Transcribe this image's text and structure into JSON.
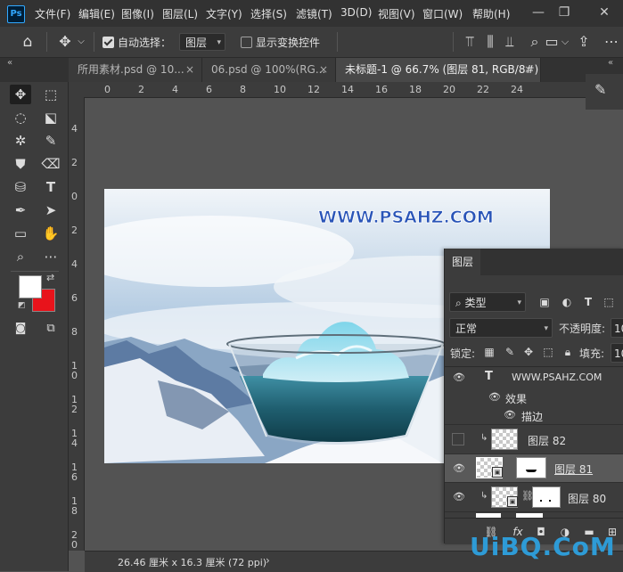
{
  "app": {
    "logo": "Ps"
  },
  "menu": [
    "文件(F)",
    "编辑(E)",
    "图像(I)",
    "图层(L)",
    "文字(Y)",
    "选择(S)",
    "滤镜(T)",
    "3D(D)",
    "视图(V)",
    "窗口(W)",
    "帮助(H)"
  ],
  "window_controls": {
    "minimize": "—",
    "restore": "❐",
    "close": "✕"
  },
  "options": {
    "auto_select_label": "自动选择：",
    "auto_select_checked": true,
    "auto_select_target": "图层",
    "show_transform_label": "显示变换控件",
    "show_transform_checked": false
  },
  "tabs": [
    {
      "label": "所用素材.psd @ 10...",
      "close": "×"
    },
    {
      "label": "06.psd @ 100%(RG...",
      "close": "×"
    },
    {
      "label": "未标题-1 @ 66.7% (图层 81, RGB/8#) *",
      "close": "×"
    }
  ],
  "panel_collapse": "«",
  "ruler_top": [
    "0",
    "2",
    "4",
    "6",
    "8",
    "10",
    "12",
    "14",
    "16",
    "18",
    "20",
    "22",
    "24"
  ],
  "ruler_left": [
    "4",
    "2",
    "0",
    "2",
    "4",
    "6",
    "8",
    "1 0",
    "1 2",
    "1 4",
    "1 6",
    "1 8",
    "2 0"
  ],
  "canvas_text": "WWW.PSAHZ.COM",
  "colors": {
    "foreground": "#ffffff",
    "background": "#e8131b",
    "accent": "#31a8ff"
  },
  "layers_panel": {
    "tab": "图层",
    "filter_kind": "类型",
    "blend_mode": "正常",
    "opacity_label": "不透明度:",
    "opacity_value": "10",
    "lock_label": "锁定:",
    "fill_label": "填充:",
    "fill_value": "10",
    "layers": [
      {
        "name": "WWW.PSAHZ.COM",
        "type": "text",
        "visible": true
      },
      {
        "name": "效果",
        "type": "effects",
        "visible": true
      },
      {
        "name": "描边",
        "type": "effect-item",
        "visible": true
      },
      {
        "name": "图层 82",
        "type": "layer",
        "visible": false,
        "clipped": true
      },
      {
        "name": "图层 81",
        "type": "layer",
        "visible": true,
        "selected": true
      },
      {
        "name": "图层 80",
        "type": "layer",
        "visible": true,
        "clipped": true,
        "linked": true
      }
    ]
  },
  "status": {
    "doc_size": "26.46 厘米 x 16.3 厘米 (72 ppi)",
    "more": "›"
  },
  "watermark": "UiBQ.CoM"
}
